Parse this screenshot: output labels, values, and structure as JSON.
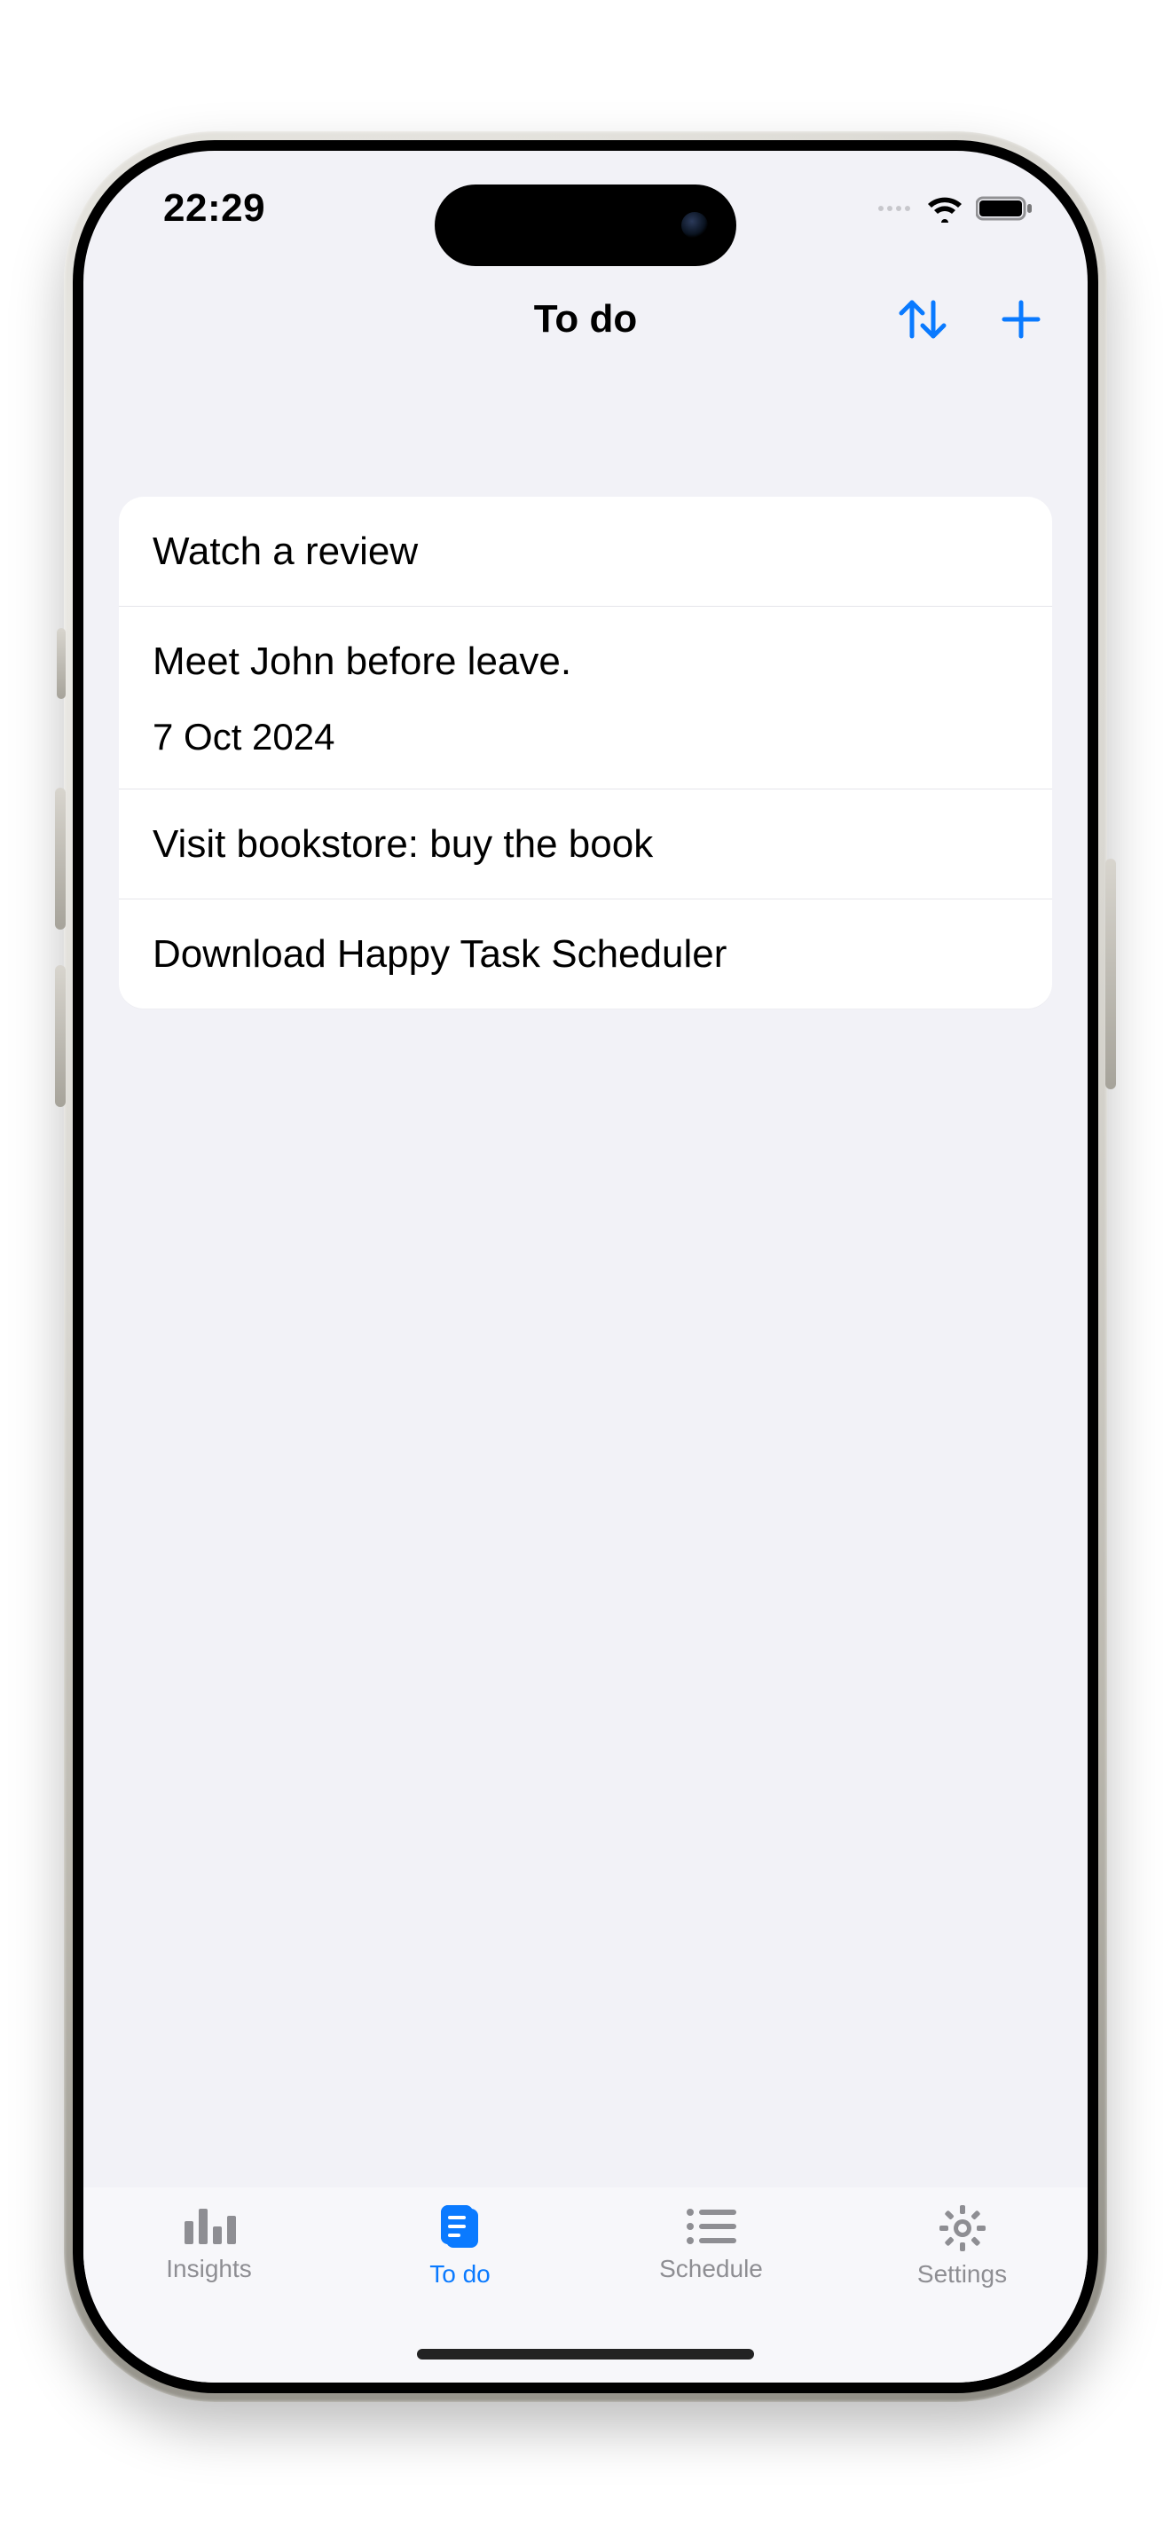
{
  "status": {
    "time": "22:29"
  },
  "nav": {
    "title": "To do"
  },
  "tasks": [
    {
      "title": "Watch a review"
    },
    {
      "title": "Meet John before leave.",
      "subtitle": "7 Oct 2024"
    },
    {
      "title": "Visit bookstore: buy the book"
    },
    {
      "title": "Download Happy Task Scheduler"
    }
  ],
  "tabs": [
    {
      "label": "Insights"
    },
    {
      "label": "To do"
    },
    {
      "label": "Schedule"
    },
    {
      "label": "Settings"
    }
  ],
  "colors": {
    "accent": "#0a7aff",
    "inactive": "#8e8e93",
    "bg": "#f2f2f7"
  }
}
